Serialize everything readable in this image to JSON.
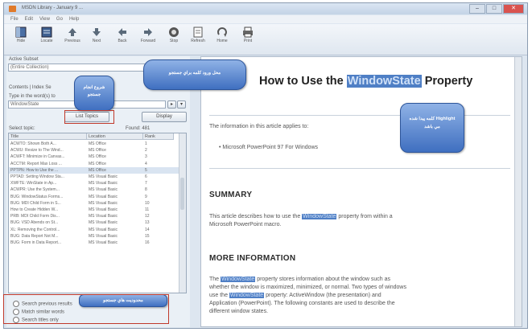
{
  "window": {
    "title": "MSDN Library - January 9 ...",
    "buttons": {
      "minimize": "–",
      "maximize": "□",
      "close": "✕"
    }
  },
  "menu": [
    "File",
    "Edit",
    "View",
    "Go",
    "Help"
  ],
  "toolbar": [
    {
      "label": "Hide",
      "icon": "hide-icon"
    },
    {
      "label": "Locate",
      "icon": "locate-icon"
    },
    {
      "label": "Previous",
      "icon": "previous-icon"
    },
    {
      "label": "Next",
      "icon": "next-icon"
    },
    {
      "label": "Back",
      "icon": "back-icon"
    },
    {
      "label": "Forward",
      "icon": "forward-icon"
    },
    {
      "label": "Stop",
      "icon": "stop-icon"
    },
    {
      "label": "Refresh",
      "icon": "refresh-icon"
    },
    {
      "label": "Home",
      "icon": "home-icon"
    },
    {
      "label": "Print",
      "icon": "print-icon"
    }
  ],
  "search": {
    "active_subset_label": "Active Subset",
    "active_subset_value": "(Entire Collection)",
    "contents_label": "Contents | Index  Se",
    "type_words_label": "Type in the word(s) to",
    "query": "WindowState",
    "list_button": "List Topics",
    "display_button": "Display",
    "select_topic_label": "Select topic:",
    "found_label": "Found: 481"
  },
  "results": {
    "columns": [
      "Title",
      "Location",
      "Rank"
    ],
    "rows": [
      [
        "ACWTO: Shown Both A...",
        "MS Office",
        "1"
      ],
      [
        "ACWU: Resize to The Wind...",
        "MS Office",
        "2"
      ],
      [
        "ACWFT: Minimize in Canvas...",
        "MS Office",
        "3"
      ],
      [
        "ACCTM: Report Max Loss ...",
        "MS Office",
        "4"
      ],
      [
        "PPTPN: How to Use the ...",
        "MS Office",
        "5"
      ],
      [
        "PPTAD: Setting Window Sta...",
        "MS Visual Basic",
        "6"
      ],
      [
        "XWFTE: WinState in Ap...",
        "MS Visual Basic",
        "7"
      ],
      [
        "ACWPR: Use the System...",
        "MS Visual Basic",
        "8"
      ],
      [
        "BUG: WindowStatus Forms...",
        "MS Visual Basic",
        "9"
      ],
      [
        "BUG: MDI Child Form in S...",
        "MS Visual Basic",
        "10"
      ],
      [
        "How to Create Hidden W...",
        "MS Visual Basic",
        "11"
      ],
      [
        "PRB: MDI Child Form Dis...",
        "MS Visual Basic",
        "12"
      ],
      [
        "BUG: VSD Abends on St...",
        "MS Visual Basic",
        "13"
      ],
      [
        "XL: Removing the Control...",
        "MS Visual Basic",
        "14"
      ],
      [
        "BUG: Data Report Not M...",
        "MS Visual Basic",
        "15"
      ],
      [
        "BUG: Form in Data Report...",
        "MS Visual Basic",
        "16"
      ]
    ]
  },
  "options": [
    "Search previous results",
    "Match similar words",
    "Search titles only"
  ],
  "document": {
    "title_before": "How to Use the ",
    "title_highlight": "WindowState",
    "title_after": " Property",
    "applies_intro": "The information in this article applies to:",
    "applies_item": "• Microsoft PowerPoint 97 For Windows",
    "summary_heading": "SUMMARY",
    "summary_line1_pre": "This article describes how to use the ",
    "summary_line1_hl": "WindowState",
    "summary_line1_post": " property from within a",
    "summary_line2": "Microsoft PowerPoint macro.",
    "more_heading": "MORE INFORMATION",
    "more_line1_hl": "WindowState",
    "more_line1_post": " property stores information about the window such as",
    "more_line1_pre": "The ",
    "more_line2": "whether the window is maximized, minimized, or normal. Two types of windows",
    "more_line3_pre": "use the ",
    "more_line3_hl": "WindowState",
    "more_line3_post": " property: ActiveWindow (the presentation) and",
    "more_line4": "Application (PowerPoint). The following constants are used to describe the",
    "more_line5": "different window states."
  },
  "callouts": {
    "search_field": "محل ورود كلمه براي جستجو",
    "start_search": "شروع انجام جستجو",
    "highlight": "كلمه پيدا شده Highlight مي باشد",
    "options": "محدوديت هاي جستجو"
  }
}
